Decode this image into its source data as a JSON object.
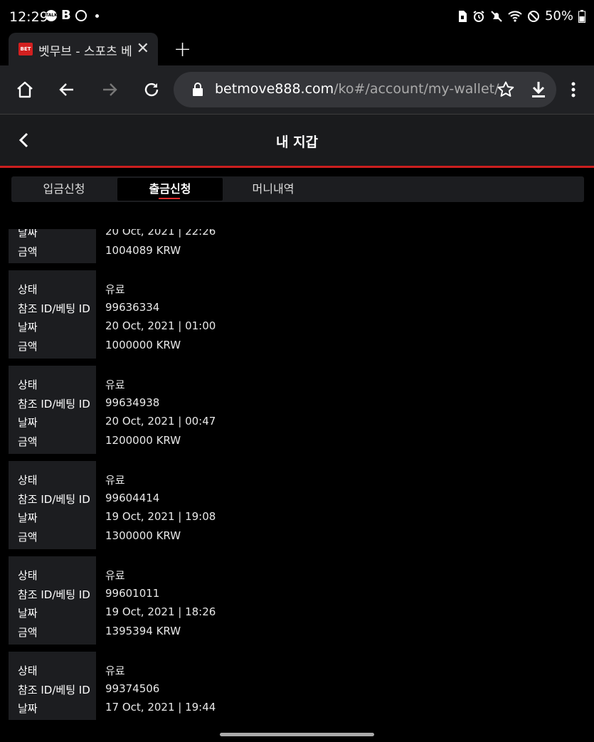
{
  "status_bar": {
    "time": "12:29",
    "battery": "50%"
  },
  "browser": {
    "tab_title": "벳무브 - 스포츠 베",
    "favicon_text": "BET",
    "url_domain": "betmove888.com",
    "url_path": "/ko#/account/my-wallet/"
  },
  "header": {
    "title": "내 지갑"
  },
  "tabs": [
    {
      "label": "입금신청"
    },
    {
      "label": "출금신청"
    },
    {
      "label": "머니내역"
    }
  ],
  "labels": {
    "status": "상태",
    "ref_id": "참조 ID/베팅 ID",
    "date": "날짜",
    "amount": "금액"
  },
  "partial_top": {
    "date": "20 Oct, 2021 | 22:26",
    "amount": "1004089 KRW"
  },
  "transactions": [
    {
      "status": "유료",
      "ref_id": "99636334",
      "date": "20 Oct, 2021 | 01:00",
      "amount": "1000000 KRW"
    },
    {
      "status": "유료",
      "ref_id": "99634938",
      "date": "20 Oct, 2021 | 00:47",
      "amount": "1200000 KRW"
    },
    {
      "status": "유료",
      "ref_id": "99604414",
      "date": "19 Oct, 2021 | 19:08",
      "amount": "1300000 KRW"
    },
    {
      "status": "유료",
      "ref_id": "99601011",
      "date": "19 Oct, 2021 | 18:26",
      "amount": "1395394 KRW"
    },
    {
      "status": "유료",
      "ref_id": "99374506",
      "date": "17 Oct, 2021 | 19:44"
    }
  ]
}
